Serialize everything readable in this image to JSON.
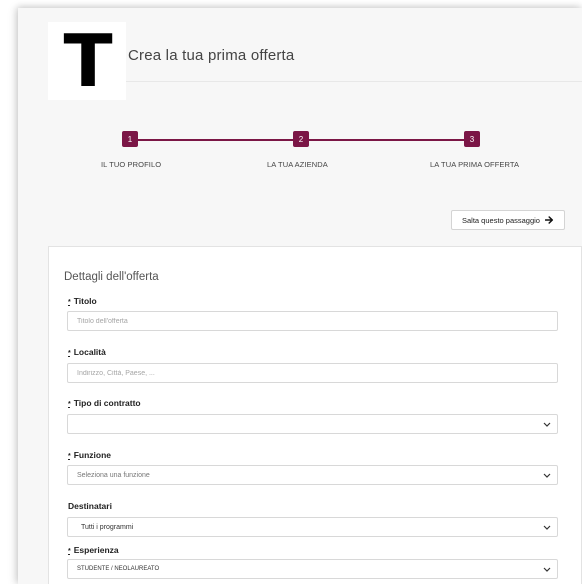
{
  "header": {
    "logo_letter": "T",
    "title": "Crea la tua prima offerta"
  },
  "stepper": {
    "steps": [
      {
        "number": "1",
        "label": "IL TUO PROFILO"
      },
      {
        "number": "2",
        "label": "LA TUA AZIENDA"
      },
      {
        "number": "3",
        "label": "LA TUA PRIMA OFFERTA"
      }
    ],
    "accent_color": "#7b1646"
  },
  "skip_button": {
    "label": "Salta questo passaggio",
    "icon": "arrow-right-icon"
  },
  "form": {
    "title": "Dettagli dell'offerta",
    "required_mark": "*",
    "fields": {
      "title": {
        "label": "Titolo",
        "placeholder": "Titolo dell'offerta",
        "value": ""
      },
      "location": {
        "label": "Località",
        "placeholder": "Indirizzo, Città, Paese, ...",
        "value": ""
      },
      "contract_type": {
        "label": "Tipo di contratto",
        "value": ""
      },
      "function": {
        "label": "Funzione",
        "value": "Seleziona una funzione"
      },
      "recipients": {
        "label": "Destinatari",
        "value": "Tutti i programmi"
      },
      "experience": {
        "label": "Esperienza",
        "value": "STUDENTE / NEOLAUREATO"
      }
    }
  }
}
